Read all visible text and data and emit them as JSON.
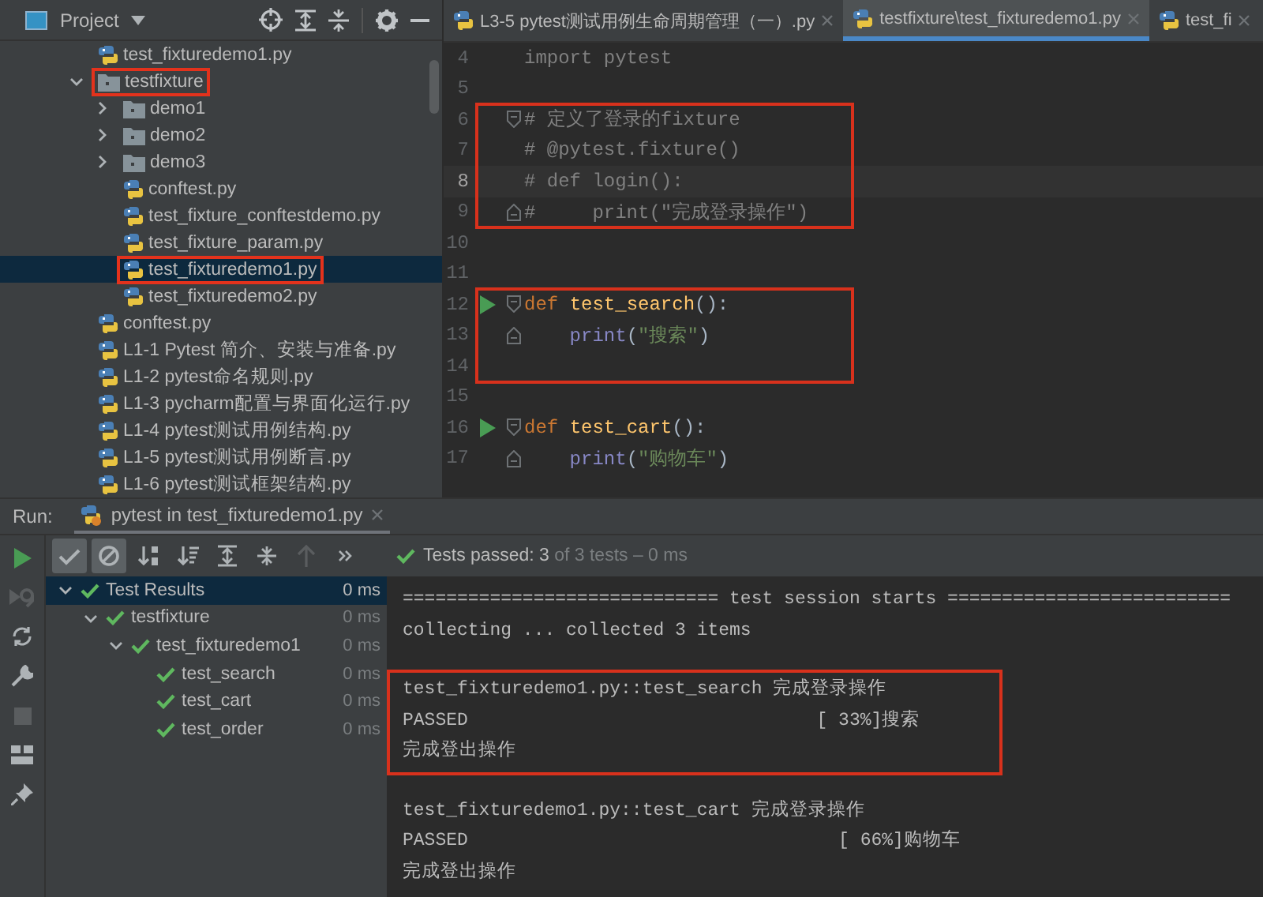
{
  "project_panel": {
    "title": "Project",
    "tree": [
      {
        "label": "test_fixturedemo1.py",
        "kind": "file",
        "selected": false,
        "highlighted": false
      },
      {
        "label": "testfixture",
        "kind": "folder",
        "expanded": true,
        "selected": false,
        "highlighted": true,
        "children": [
          {
            "label": "demo1",
            "kind": "folder",
            "expanded": false,
            "selected": false,
            "highlighted": false
          },
          {
            "label": "demo2",
            "kind": "folder",
            "expanded": false,
            "selected": false,
            "highlighted": false
          },
          {
            "label": "demo3",
            "kind": "folder",
            "expanded": false,
            "selected": false,
            "highlighted": false
          },
          {
            "label": "conftest.py",
            "kind": "file",
            "selected": false,
            "highlighted": false
          },
          {
            "label": "test_fixture_conftestdemo.py",
            "kind": "file",
            "selected": false,
            "highlighted": false
          },
          {
            "label": "test_fixture_param.py",
            "kind": "file",
            "selected": false,
            "highlighted": false
          },
          {
            "label": "test_fixturedemo1.py",
            "kind": "file",
            "selected": true,
            "highlighted": true
          },
          {
            "label": "test_fixturedemo2.py",
            "kind": "file",
            "selected": false,
            "highlighted": false
          }
        ]
      },
      {
        "label": "conftest.py",
        "kind": "file",
        "selected": false,
        "highlighted": false
      },
      {
        "label": "L1-1 Pytest 简介、安装与准备.py",
        "kind": "file",
        "selected": false,
        "highlighted": false
      },
      {
        "label": "L1-2 pytest命名规则.py",
        "kind": "file",
        "selected": false,
        "highlighted": false
      },
      {
        "label": "L1-3 pycharm配置与界面化运行.py",
        "kind": "file",
        "selected": false,
        "highlighted": false
      },
      {
        "label": "L1-4 pytest测试用例结构.py",
        "kind": "file",
        "selected": false,
        "highlighted": false
      },
      {
        "label": "L1-5 pytest测试用例断言.py",
        "kind": "file",
        "selected": false,
        "highlighted": false
      },
      {
        "label": "L1-6 pytest测试框架结构.py",
        "kind": "file",
        "selected": false,
        "highlighted": false
      }
    ]
  },
  "editor": {
    "tabs": [
      {
        "label": "L3-5 pytest测试用例生命周期管理（一）.py",
        "selected": false
      },
      {
        "label": "testfixture\\test_fixturedemo1.py",
        "selected": true
      },
      {
        "label": "test_fi",
        "selected": false
      }
    ],
    "blocks": [
      {
        "highlighted": false,
        "lines": [
          {
            "number": "4",
            "kind": "plain",
            "current": false,
            "run": false,
            "tokens": [
              {
                "kind": "unused",
                "text": "import pytest"
              }
            ]
          },
          {
            "number": "5",
            "kind": "plain",
            "current": false,
            "run": false
          }
        ]
      },
      {
        "highlighted": true,
        "lines": [
          {
            "number": "6",
            "kind": "fold-start",
            "current": false,
            "run": false,
            "tokens": [
              {
                "kind": "comment",
                "text": "# 定义了登录的fixture"
              }
            ]
          },
          {
            "number": "7",
            "kind": "plain",
            "current": false,
            "run": false,
            "tokens": [
              {
                "kind": "comment",
                "text": "# @pytest.fixture()"
              }
            ]
          },
          {
            "number": "8",
            "kind": "plain",
            "current": true,
            "run": false,
            "tokens": [
              {
                "kind": "comment",
                "text": "# def login():"
              }
            ]
          },
          {
            "number": "9",
            "kind": "fold-end",
            "current": false,
            "run": false,
            "tokens": [
              {
                "kind": "comment",
                "text": "#     print(\"完成登录操作\")"
              }
            ]
          }
        ]
      },
      {
        "highlighted": false,
        "lines": [
          {
            "number": "10",
            "kind": "plain",
            "current": false,
            "run": false
          },
          {
            "number": "11",
            "kind": "plain",
            "current": false,
            "run": false
          }
        ]
      },
      {
        "highlighted": true,
        "lines": [
          {
            "number": "12",
            "kind": "fold-start",
            "current": false,
            "run": true,
            "tokens": [
              {
                "kind": "keyword",
                "text": "def "
              },
              {
                "kind": "function",
                "text": "test_search"
              },
              {
                "kind": "plain",
                "text": "():"
              }
            ]
          },
          {
            "number": "13",
            "kind": "fold-end",
            "current": false,
            "run": false,
            "indent": true,
            "tokens": [
              {
                "kind": "builtin",
                "text": "print"
              },
              {
                "kind": "plain",
                "text": "("
              },
              {
                "kind": "string",
                "text": "\"搜索\""
              },
              {
                "kind": "plain",
                "text": ")"
              }
            ]
          },
          {
            "number": "14",
            "kind": "plain",
            "current": false,
            "run": false
          }
        ]
      },
      {
        "highlighted": false,
        "lines": [
          {
            "number": "15",
            "kind": "plain",
            "current": false,
            "run": false
          },
          {
            "number": "16",
            "kind": "fold-start",
            "current": false,
            "run": true,
            "tokens": [
              {
                "kind": "keyword",
                "text": "def "
              },
              {
                "kind": "function",
                "text": "test_cart"
              },
              {
                "kind": "plain",
                "text": "():"
              }
            ]
          },
          {
            "number": "17",
            "kind": "fold-end",
            "current": false,
            "run": false,
            "indent": true,
            "tokens": [
              {
                "kind": "builtin",
                "text": "print"
              },
              {
                "kind": "plain",
                "text": "("
              },
              {
                "kind": "string",
                "text": "\"购物车\""
              },
              {
                "kind": "plain",
                "text": ")"
              }
            ]
          }
        ]
      }
    ]
  },
  "run_panel": {
    "label": "Run:",
    "tab": {
      "label": "pytest in test_fixturedemo1.py",
      "selected": true
    },
    "side_tools": [
      {
        "kind": "run",
        "disabled": false
      },
      {
        "kind": "rerun-failed",
        "disabled": true
      },
      {
        "kind": "toggle-auto",
        "disabled": false
      },
      {
        "kind": "settings",
        "disabled": false
      },
      {
        "kind": "stop",
        "disabled": true
      },
      {
        "kind": "layout",
        "disabled": false
      },
      {
        "kind": "pin",
        "disabled": false
      }
    ],
    "toolbar": [
      {
        "kind": "show-passed",
        "selected": true,
        "disabled": false
      },
      {
        "kind": "show-ignored",
        "selected": true,
        "disabled": false
      },
      {
        "kind": "sort-alpha",
        "selected": false,
        "disabled": false
      },
      {
        "kind": "sort-duration",
        "selected": false,
        "disabled": false
      },
      {
        "kind": "expand-all",
        "selected": false,
        "disabled": false
      },
      {
        "kind": "collapse-all",
        "selected": false,
        "disabled": false
      },
      {
        "kind": "previous",
        "selected": false,
        "disabled": true
      },
      {
        "kind": "more",
        "selected": false,
        "disabled": false
      }
    ],
    "status": {
      "passed": true,
      "text": "Tests passed: 3",
      "rest": " of 3 tests – 0 ms"
    },
    "results": [
      {
        "label": "Test Results",
        "time": "0 ms",
        "passed": true,
        "expanded": true,
        "selected": true,
        "children": [
          {
            "label": "testfixture",
            "time": "0 ms",
            "passed": true,
            "expanded": true,
            "selected": false,
            "children": [
              {
                "label": "test_fixturedemo1",
                "time": "0 ms",
                "passed": true,
                "expanded": true,
                "selected": false,
                "children": [
                  {
                    "label": "test_search",
                    "time": "0 ms",
                    "passed": true,
                    "selected": false
                  },
                  {
                    "label": "test_cart",
                    "time": "0 ms",
                    "passed": true,
                    "selected": false
                  },
                  {
                    "label": "test_order",
                    "time": "0 ms",
                    "passed": true,
                    "selected": false
                  }
                ]
              }
            ]
          }
        ]
      }
    ],
    "console": [
      {
        "highlighted": false,
        "lines": [
          "============================= test session starts ==========================",
          "collecting ... collected 3 items"
        ]
      },
      {
        "highlighted": true,
        "lines": [
          "test_fixturedemo1.py::test_search 完成登录操作",
          "PASSED                                [ 33%]搜索",
          "完成登出操作"
        ]
      },
      {
        "highlighted": false,
        "lines": [
          "test_fixturedemo1.py::test_cart 完成登录操作",
          "PASSED                                  [ 66%]购物车",
          "完成登出操作"
        ]
      }
    ]
  }
}
